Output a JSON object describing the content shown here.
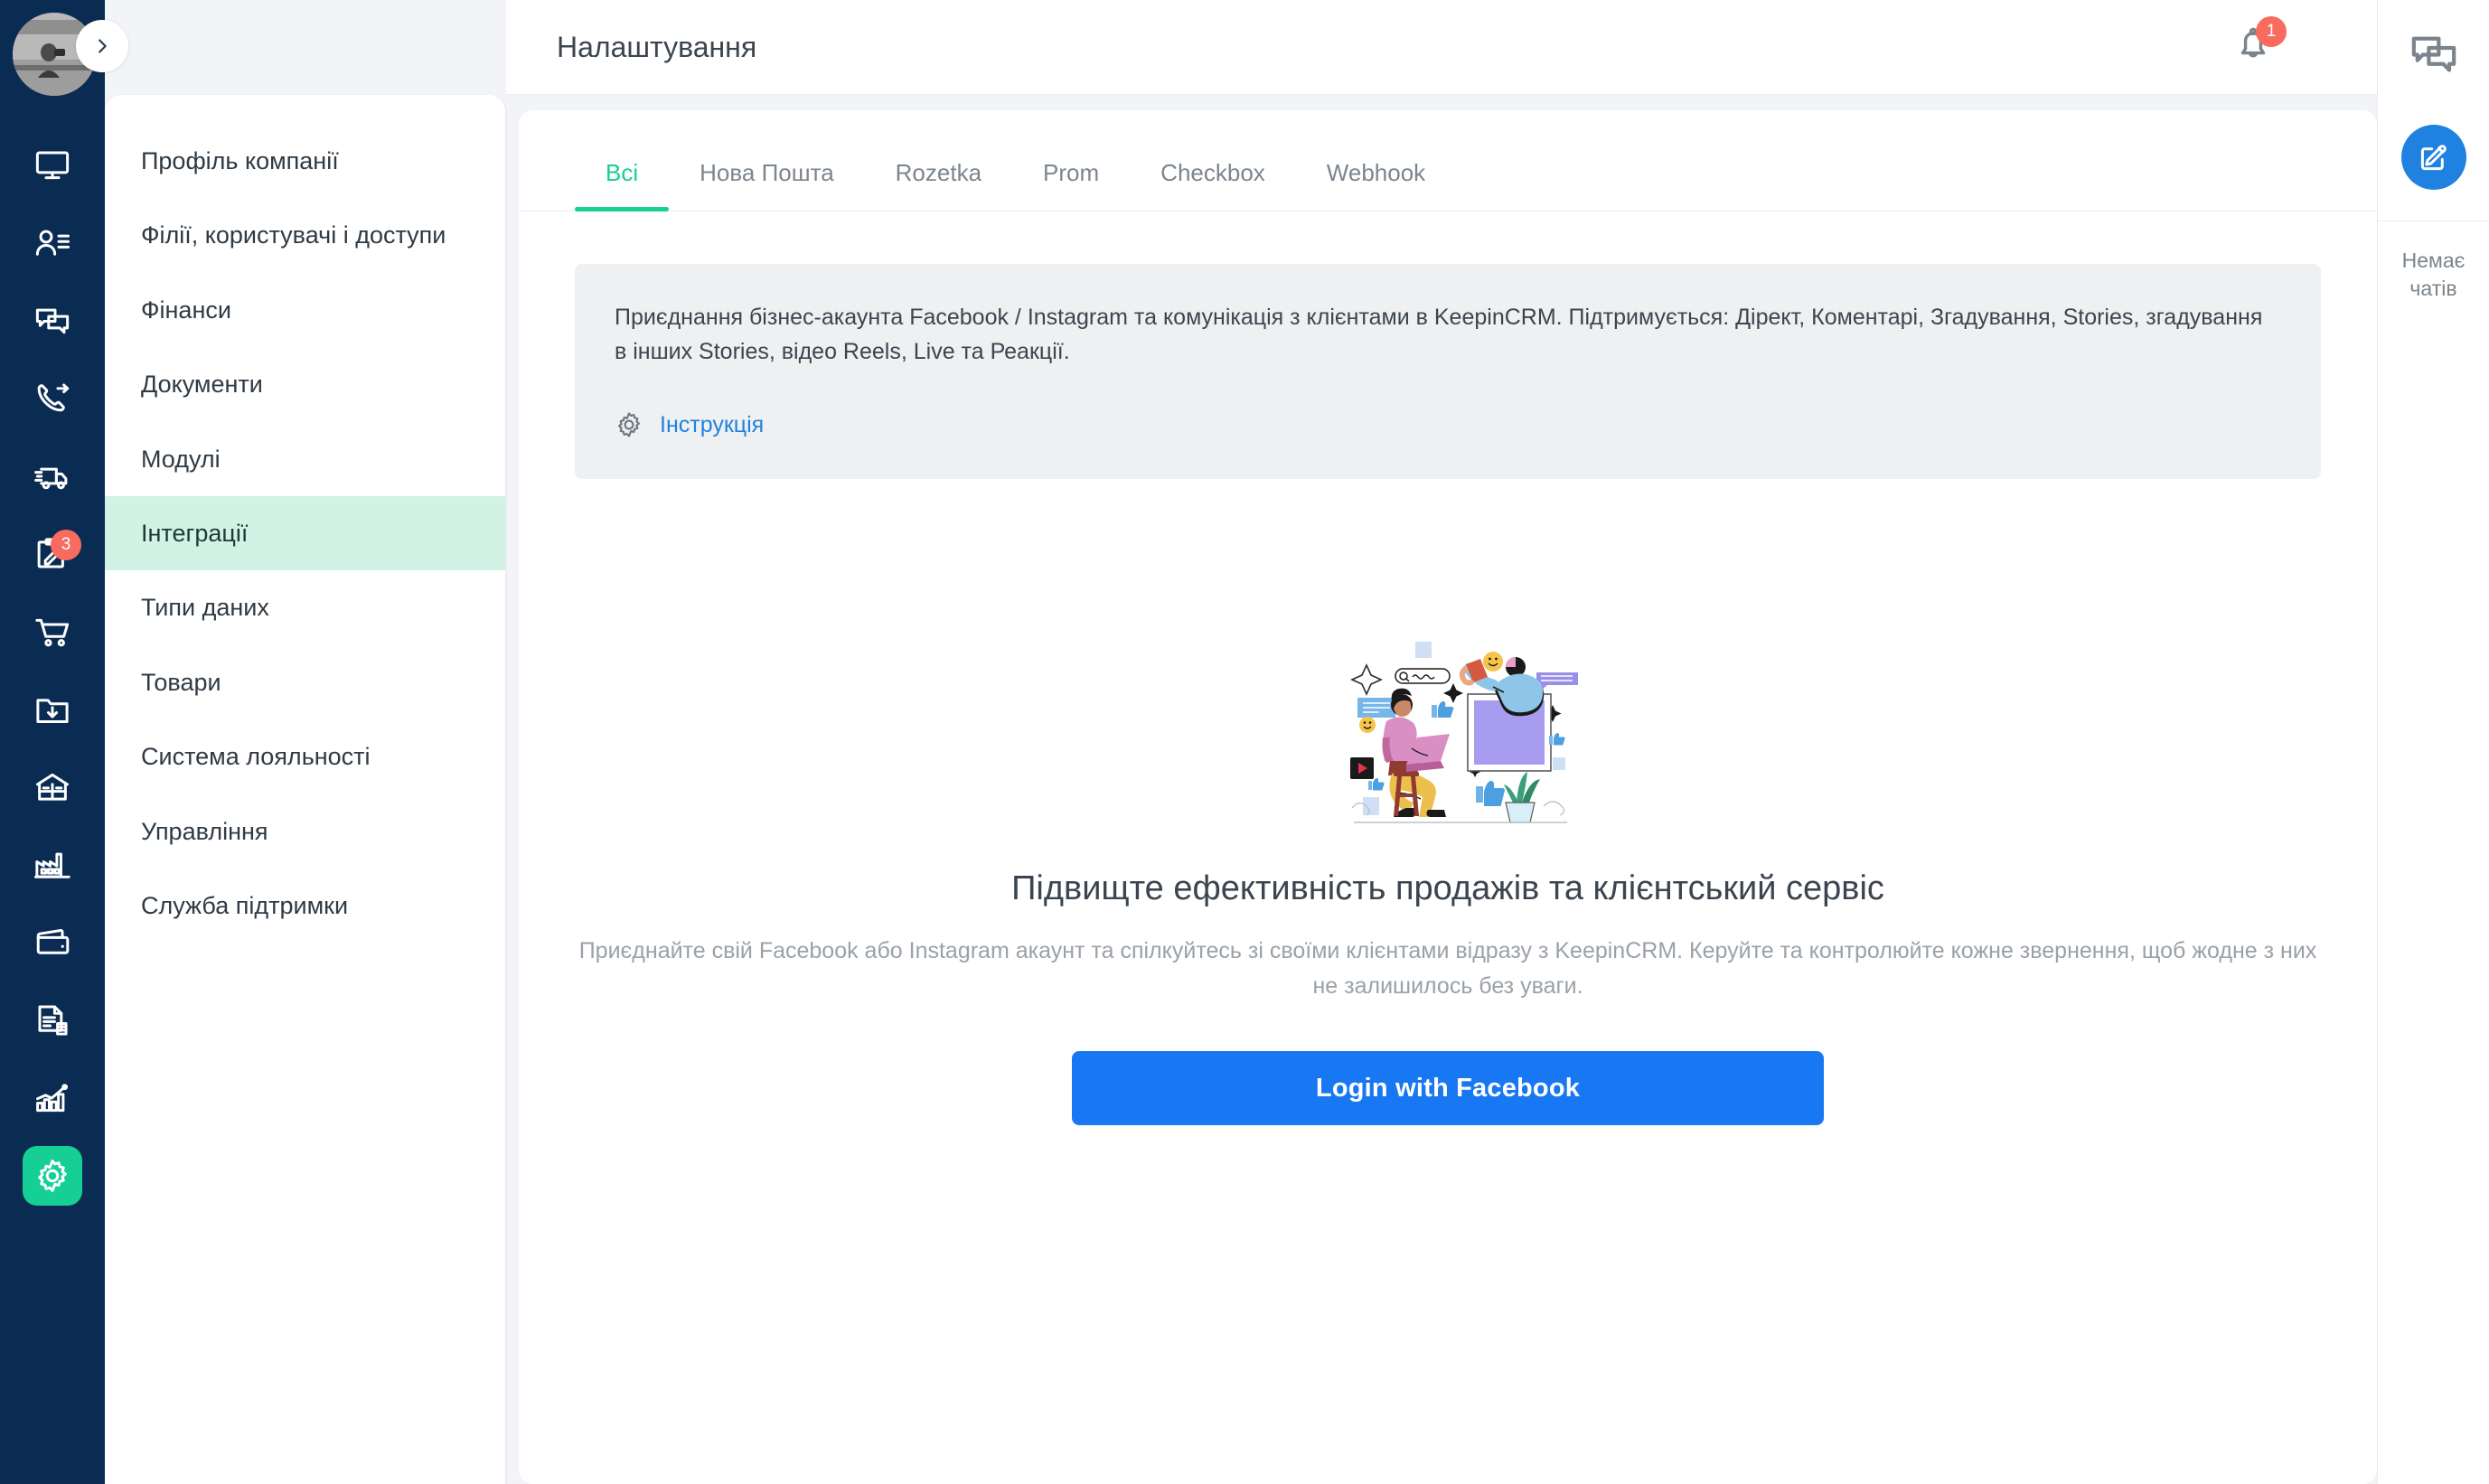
{
  "rail": {
    "avatar_label": "user-avatar",
    "collapse_label": "expand-sidebar",
    "items": [
      {
        "icon": "monitor-icon",
        "name": "sidebar-item-dashboard",
        "badge": ""
      },
      {
        "icon": "contacts-icon",
        "name": "sidebar-item-clients",
        "badge": ""
      },
      {
        "icon": "chat-icon",
        "name": "sidebar-item-chats",
        "badge": ""
      },
      {
        "icon": "call-forward-icon",
        "name": "sidebar-item-calls",
        "badge": ""
      },
      {
        "icon": "truck-icon",
        "name": "sidebar-item-delivery",
        "badge": ""
      },
      {
        "icon": "clipboard-edit-icon",
        "name": "sidebar-item-tasks",
        "badge": "3"
      },
      {
        "icon": "cart-icon",
        "name": "sidebar-item-orders",
        "badge": ""
      },
      {
        "icon": "folder-download-icon",
        "name": "sidebar-item-import",
        "badge": ""
      },
      {
        "icon": "warehouse-icon",
        "name": "sidebar-item-warehouse",
        "badge": ""
      },
      {
        "icon": "factory-icon",
        "name": "sidebar-item-production",
        "badge": ""
      },
      {
        "icon": "wallet-icon",
        "name": "sidebar-item-finance",
        "badge": ""
      },
      {
        "icon": "document-icon",
        "name": "sidebar-item-documents",
        "badge": ""
      },
      {
        "icon": "analytics-icon",
        "name": "sidebar-item-analytics",
        "badge": ""
      },
      {
        "icon": "gear-icon",
        "name": "sidebar-item-settings",
        "badge": "",
        "active": true
      }
    ]
  },
  "header": {
    "title": "Налаштування",
    "notifications_count": "1"
  },
  "settings_menu": {
    "items": [
      {
        "label": "Профіль компанії",
        "active": false
      },
      {
        "label": "Філії, користувачі і доступи",
        "active": false
      },
      {
        "label": "Фінанси",
        "active": false
      },
      {
        "label": "Документи",
        "active": false
      },
      {
        "label": "Модулі",
        "active": false
      },
      {
        "label": "Інтеграції",
        "active": true
      },
      {
        "label": "Типи даних",
        "active": false
      },
      {
        "label": "Товари",
        "active": false
      },
      {
        "label": "Система лояльності",
        "active": false
      },
      {
        "label": "Управління",
        "active": false
      },
      {
        "label": "Служба підтримки",
        "active": false
      }
    ]
  },
  "tabs": [
    {
      "label": "Всі",
      "active": true
    },
    {
      "label": "Нова Пошта",
      "active": false
    },
    {
      "label": "Rozetka",
      "active": false
    },
    {
      "label": "Prom",
      "active": false
    },
    {
      "label": "Checkbox",
      "active": false
    },
    {
      "label": "Webhook",
      "active": false
    }
  ],
  "info_box": {
    "text": "Приєднання бізнес-акаунта Facebook / Instagram та комунікація з клієнтами в KeepinCRM. Підтримується: Дірект, Коментарі, Згадування, Stories, згадування в інших Stories, відео Reels, Live та Реакції.",
    "instruction_label": "Інструкція"
  },
  "empty_state": {
    "title": "Підвищте ефективність продажів та клієнтський сервіс",
    "description": "Приєднайте свій Facebook або Instagram акаунт та спілкуйтесь зі своїми клієнтами відразу з KeepinCRM. Керуйте та контролюйте кожне звернення, щоб жодне з них не залишилось без уваги.",
    "button_label": "Login with Facebook"
  },
  "chat_panel": {
    "empty_text": "Немає чатів"
  },
  "colors": {
    "rail_bg": "#0b2c52",
    "accent_green": "#16cf95",
    "active_menu_bg": "#d2f2e6",
    "link_blue": "#1f82e0",
    "facebook_blue": "#1877f2",
    "badge_red": "#f96a5f",
    "page_bg": "#f2f4f7"
  }
}
